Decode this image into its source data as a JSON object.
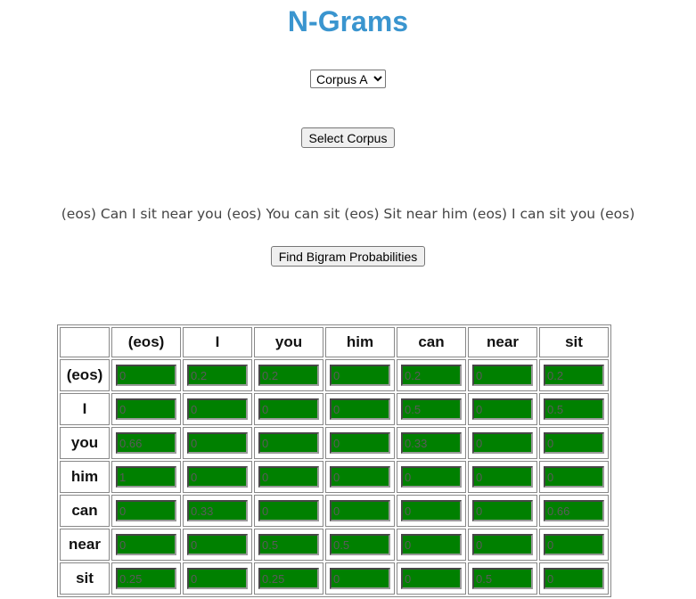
{
  "page": {
    "title": "N-Grams",
    "corpus_select": {
      "selected": "Corpus A",
      "options": [
        "Corpus A"
      ]
    },
    "select_button_label": "Select Corpus",
    "corpus_text": "(eos) Can I sit near you (eos) You can sit (eos) Sit near him (eos) I can sit you (eos)",
    "find_button_label": "Find Bigram Probabilities"
  },
  "colors": {
    "title": "#3a95cf",
    "cell_background": "#008000"
  },
  "table": {
    "columns": [
      "(eos)",
      "I",
      "you",
      "him",
      "can",
      "near",
      "sit"
    ],
    "rows": [
      {
        "label": "(eos)",
        "values": [
          "0",
          "0.2",
          "0.2",
          "0",
          "0.2",
          "0",
          "0.2"
        ]
      },
      {
        "label": "I",
        "values": [
          "0",
          "0",
          "0",
          "0",
          "0.5",
          "0",
          "0.5"
        ]
      },
      {
        "label": "you",
        "values": [
          "0.66",
          "0",
          "0",
          "0",
          "0.33",
          "0",
          "0"
        ]
      },
      {
        "label": "him",
        "values": [
          "1",
          "0",
          "0",
          "0",
          "0",
          "0",
          "0"
        ]
      },
      {
        "label": "can",
        "values": [
          "0",
          "0.33",
          "0",
          "0",
          "0",
          "0",
          "0.66"
        ]
      },
      {
        "label": "near",
        "values": [
          "0",
          "0",
          "0.5",
          "0.5",
          "0",
          "0",
          "0"
        ]
      },
      {
        "label": "sit",
        "values": [
          "0.25",
          "0",
          "0.25",
          "0",
          "0",
          "0.5",
          "0"
        ]
      }
    ]
  }
}
